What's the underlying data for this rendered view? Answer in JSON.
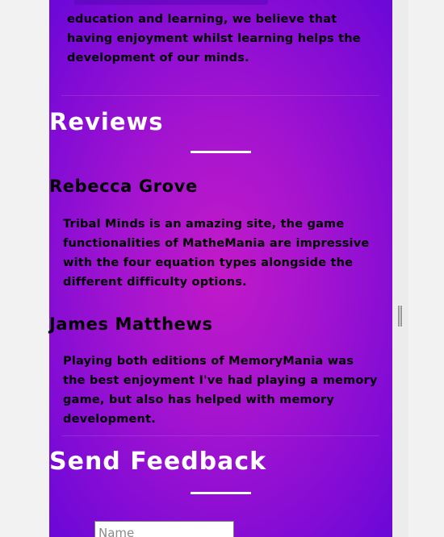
{
  "about": {
    "text": "education and learning, we believe that having enjoyment whilst learning helps the development of our minds."
  },
  "reviews": {
    "title": "Reviews",
    "items": [
      {
        "name": "Rebecca Grove",
        "text": "Tribal Minds is an amazing site, the game functionalities of MatheMania are impressive with the four equation types alongside the different difficulty options."
      },
      {
        "name": "James Matthews",
        "text": "Playing both editions of MemoryMania was the best enjoyment I've had playing a memory game, but also has helped with memory development."
      }
    ]
  },
  "feedback": {
    "title": "Send Feedback",
    "name_placeholder": "Name",
    "name_value": ""
  },
  "colors": {
    "panel_center": "#c21ac8",
    "panel_edge": "#6a08d8",
    "text": "#ffffff"
  }
}
